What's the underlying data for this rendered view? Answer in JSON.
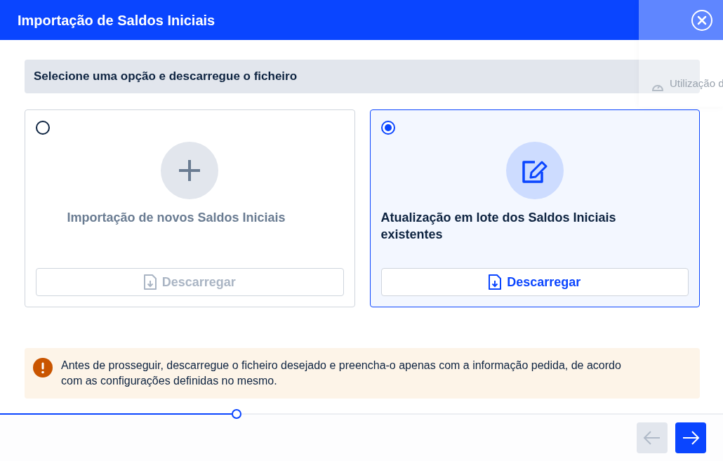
{
  "window": {
    "title": "Importação de Saldos Iniciais"
  },
  "section_title": "Selecione uma opção e descarregue o ficheiro",
  "options": [
    {
      "kind": "new",
      "selected": false,
      "title": "Importação de novos Saldos Iniciais",
      "button": "Descarregar"
    },
    {
      "kind": "update",
      "selected": true,
      "title": "Atualização em lote dos Saldos Iniciais existentes",
      "button": "Descarregar"
    }
  ],
  "alert": {
    "text": "Antes de prosseguir, descarregue o ficheiro desejado e preencha-o apenas com a informação pedida, de acordo com as configurações definidas no mesmo."
  },
  "progress": {
    "level": 0.327
  },
  "nav": {
    "back_disabled": true,
    "next_disabled": false
  },
  "background_panel": {
    "text": "Utilização d"
  }
}
